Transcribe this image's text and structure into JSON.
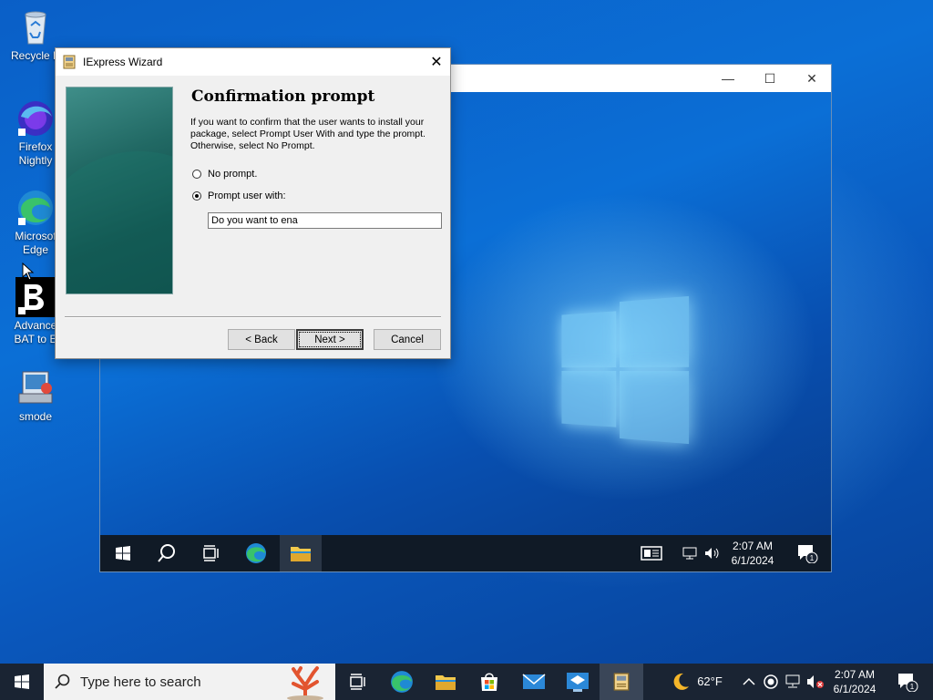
{
  "desktop": {
    "icons": [
      {
        "label": "Recycle B",
        "icon": "recycle-bin-icon"
      },
      {
        "label": "Firefox\nNightly",
        "icon": "firefox-nightly-icon"
      },
      {
        "label": "Microsof\nEdge",
        "icon": "edge-icon"
      },
      {
        "label": "Advance\nBAT to E",
        "icon": "bat-to-exe-icon"
      },
      {
        "label": "smode",
        "icon": "smode-icon"
      }
    ]
  },
  "vm": {
    "controls": {
      "minimize": "—",
      "maximize": "☐",
      "close": "✕"
    },
    "taskbar": {
      "time": "2:07 AM",
      "date": "6/1/2024",
      "notifications": "1"
    }
  },
  "dialog": {
    "title": "IExpress Wizard",
    "close": "✕",
    "heading": "Confirmation prompt",
    "description": "If you want to confirm that the user wants to install your package, select Prompt User With and type the prompt. Otherwise, select No Prompt.",
    "options": [
      {
        "label": "No prompt.",
        "selected": false
      },
      {
        "label": "Prompt user with:",
        "selected": true
      }
    ],
    "prompt_value": "Do you want to ena",
    "buttons": {
      "back": "< Back",
      "next": "Next >",
      "cancel": "Cancel"
    }
  },
  "taskbar": {
    "search_placeholder": "Type here to search",
    "weather": "62°F",
    "time": "2:07 AM",
    "date": "6/1/2024",
    "notifications": "1"
  }
}
